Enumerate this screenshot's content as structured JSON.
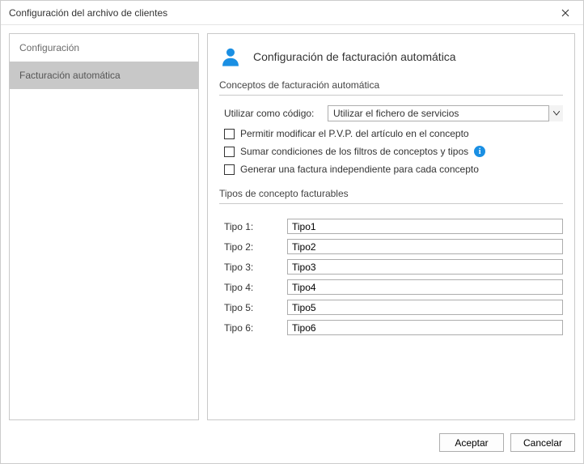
{
  "window": {
    "title": "Configuración del archivo de clientes"
  },
  "sidebar": {
    "items": [
      {
        "label": "Configuración",
        "active": false
      },
      {
        "label": "Facturación automática",
        "active": true
      }
    ]
  },
  "main": {
    "heading": "Configuración de facturación automática",
    "group1": {
      "title": "Conceptos de facturación automática",
      "use_as_code_label": "Utilizar como código:",
      "use_as_code_value": "Utilizar el fichero de servicios",
      "chk_modify_pvp": "Permitir modificar el P.V.P. del artículo en el concepto",
      "chk_sum_conditions": "Sumar condiciones de los filtros de conceptos y tipos",
      "chk_independent_invoice": "Generar una factura independiente para cada concepto"
    },
    "group2": {
      "title": "Tipos de concepto facturables",
      "types": [
        {
          "label": "Tipo 1:",
          "value": "Tipo1"
        },
        {
          "label": "Tipo 2:",
          "value": "Tipo2"
        },
        {
          "label": "Tipo 3:",
          "value": "Tipo3"
        },
        {
          "label": "Tipo 4:",
          "value": "Tipo4"
        },
        {
          "label": "Tipo 5:",
          "value": "Tipo5"
        },
        {
          "label": "Tipo 6:",
          "value": "Tipo6"
        }
      ]
    }
  },
  "footer": {
    "accept": "Aceptar",
    "cancel": "Cancelar"
  },
  "colors": {
    "accent": "#1a8fe3"
  }
}
